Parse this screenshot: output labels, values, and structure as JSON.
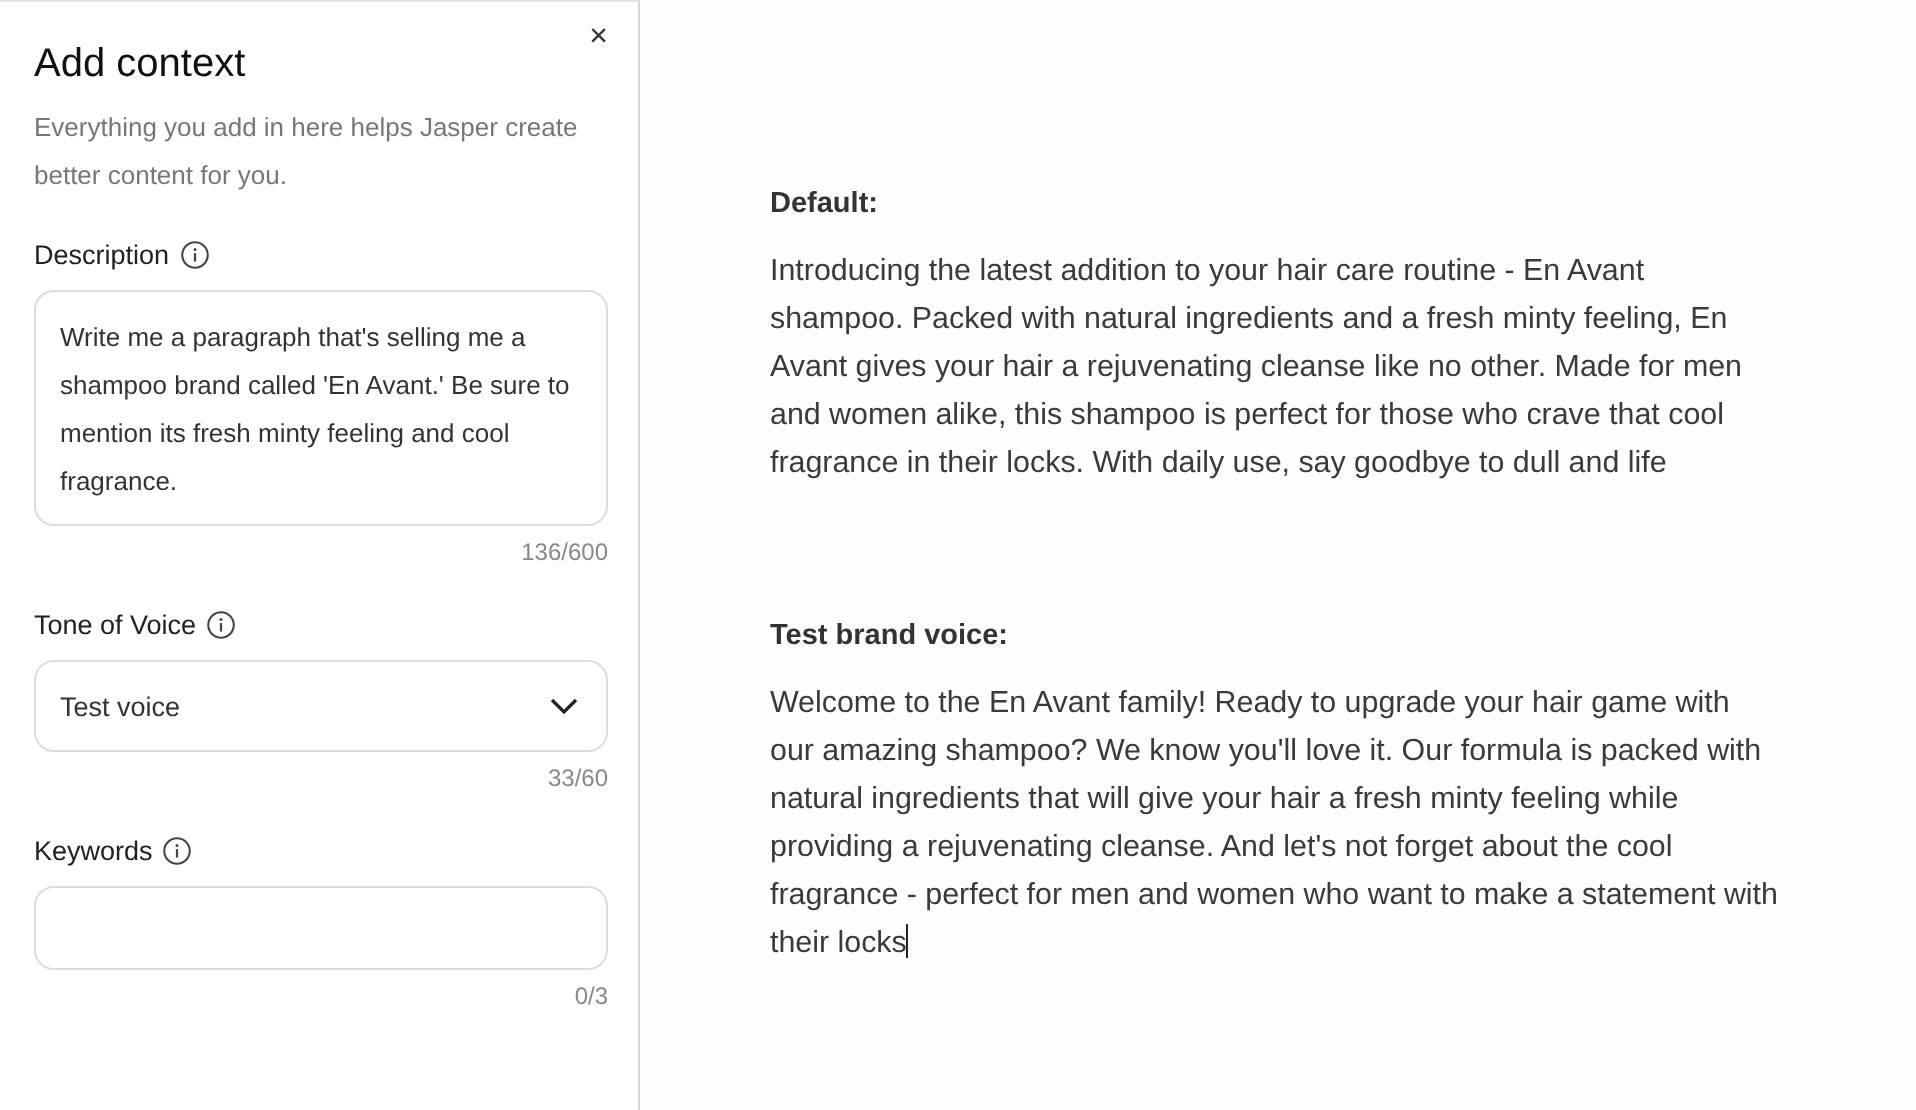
{
  "panel": {
    "title": "Add context",
    "close": "×",
    "subtitle": "Everything you add in here helps Jasper create better content for you.",
    "description": {
      "label": "Description",
      "value": "Write me a paragraph that's selling me a shampoo brand called 'En Avant.' Be sure to mention its fresh minty feeling and cool fragrance.",
      "count": "136/600"
    },
    "tone": {
      "label": "Tone of Voice",
      "value": "Test voice",
      "count": "33/60"
    },
    "keywords": {
      "label": "Keywords",
      "count": "0/3"
    }
  },
  "outputs": [
    {
      "heading": "Default:",
      "text": "Introducing the latest addition to your hair care routine - En Avant shampoo. Packed with natural ingredients and a fresh minty feeling, En Avant gives your hair a rejuvenating cleanse like no other. Made for men and women alike, this shampoo is perfect for those who crave that cool fragrance in their locks. With daily use, say goodbye to dull and life",
      "focused": false
    },
    {
      "heading": "Test brand voice:",
      "text": "Welcome to the En Avant family! Ready to upgrade your hair game with our amazing shampoo? We know you'll love it. Our formula is packed with natural ingredients that will give your hair a fresh minty feeling while providing a rejuvenating cleanse. And let's not forget about the cool fragrance - perfect for men and women who want to make a statement with their locks",
      "focused": true
    }
  ]
}
